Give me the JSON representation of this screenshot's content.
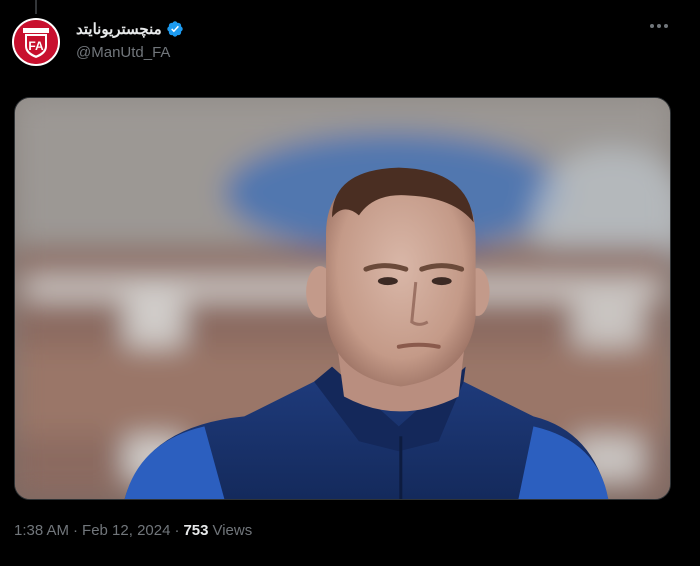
{
  "tweet": {
    "display_name": "منچستریونایتد",
    "handle": "@ManUtd_FA",
    "avatar_text": "FA",
    "time": "1:38 AM",
    "separator": "·",
    "date": "Feb 12, 2024",
    "views_count": "753",
    "views_label": "Views"
  },
  "icons": {
    "verified": "verified-badge-icon",
    "more": "more-options-icon"
  },
  "colors": {
    "background": "#000000",
    "verified_blue": "#1d9bf0",
    "muted_text": "#71767b",
    "avatar_red": "#c8102e"
  }
}
